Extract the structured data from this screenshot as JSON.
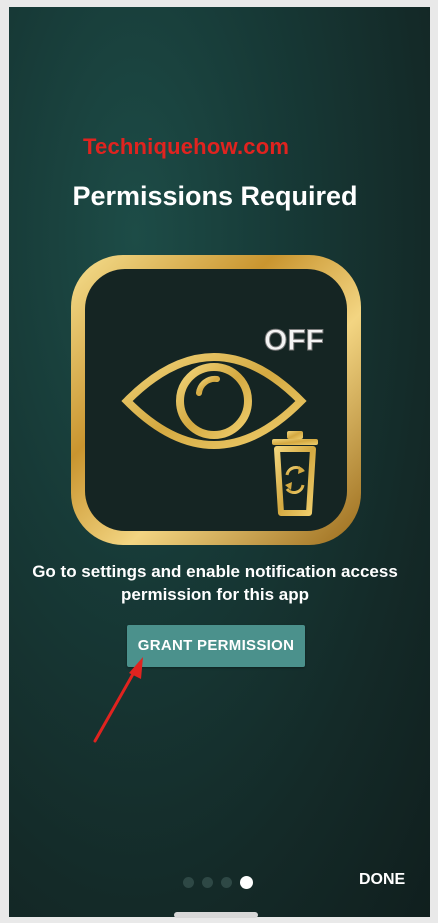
{
  "watermark": "Techniquehow.com",
  "screen": {
    "title": "Permissions Required",
    "icon_badge": "OFF",
    "description_line1": "Go to settings and enable notification access",
    "description_line2": "permission for this app",
    "grant_button": "GRANT PERMISSION",
    "done_button": "DONE"
  },
  "pager": {
    "total_pages": 4,
    "current_page": 4
  },
  "colors": {
    "background": "#173a37",
    "button": "#4b918c",
    "accent_gold": "#d4a941",
    "watermark_red": "#e0231f",
    "arrow_red": "#e0231f"
  },
  "icons": [
    "eye-icon",
    "trash-restore-icon",
    "red-arrow-annotation"
  ]
}
